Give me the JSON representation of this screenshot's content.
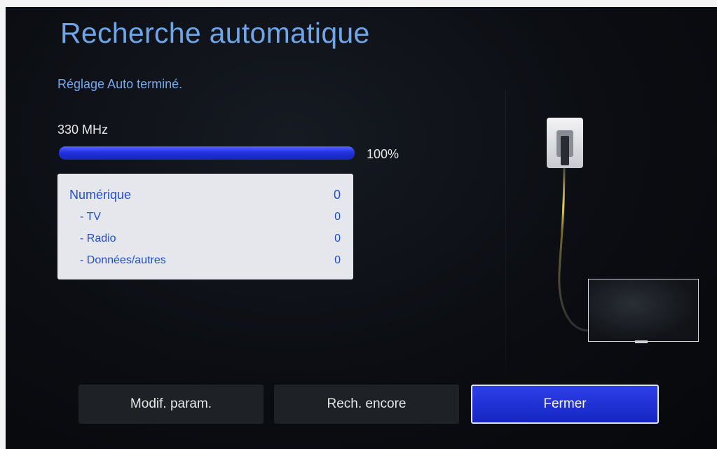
{
  "title": "Recherche automatique",
  "status": "Réglage Auto terminé.",
  "frequency": "330 MHz",
  "progress": {
    "value": 100,
    "label": "100%"
  },
  "results": [
    {
      "label": "Numérique",
      "count": "0"
    },
    {
      "label": "- TV",
      "count": "0"
    },
    {
      "label": "- Radio",
      "count": "0"
    },
    {
      "label": "- Données/autres",
      "count": "0"
    }
  ],
  "buttons": {
    "modify": "Modif. param.",
    "search_again": "Rech. encore",
    "close": "Fermer"
  },
  "colors": {
    "accent": "#6ea6e8",
    "progress": "#2233e0",
    "count_text": "#1f4fd1",
    "focused_button": "#1e33d8",
    "cable_glow": "#e8d24a"
  },
  "icons": {
    "antenna": "antenna-socket-icon",
    "tv": "tv-icon"
  }
}
